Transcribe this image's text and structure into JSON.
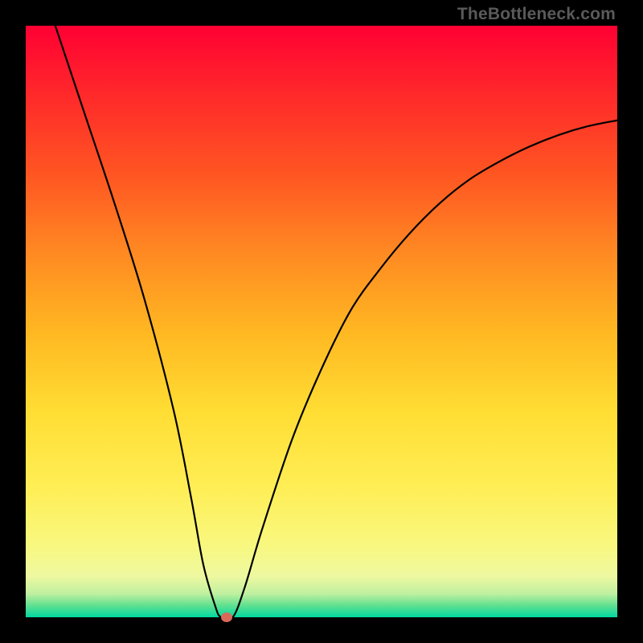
{
  "watermark": "TheBottleneck.com",
  "chart_data": {
    "type": "line",
    "title": "",
    "xlabel": "",
    "ylabel": "",
    "xlim": [
      0,
      100
    ],
    "ylim": [
      0,
      100
    ],
    "series": [
      {
        "name": "curve",
        "x": [
          5,
          10,
          15,
          20,
          25,
          28,
          30,
          32,
          33,
          35,
          37,
          40,
          45,
          50,
          55,
          60,
          65,
          70,
          75,
          80,
          85,
          90,
          95,
          100
        ],
        "y": [
          100,
          85,
          70,
          54,
          35,
          20,
          9,
          2,
          0,
          0,
          5,
          15,
          30,
          42,
          52,
          59,
          65,
          70,
          74,
          77,
          79.5,
          81.5,
          83,
          84
        ]
      }
    ],
    "marker": {
      "x": 34,
      "y": 0,
      "color": "#d86a5a"
    }
  }
}
